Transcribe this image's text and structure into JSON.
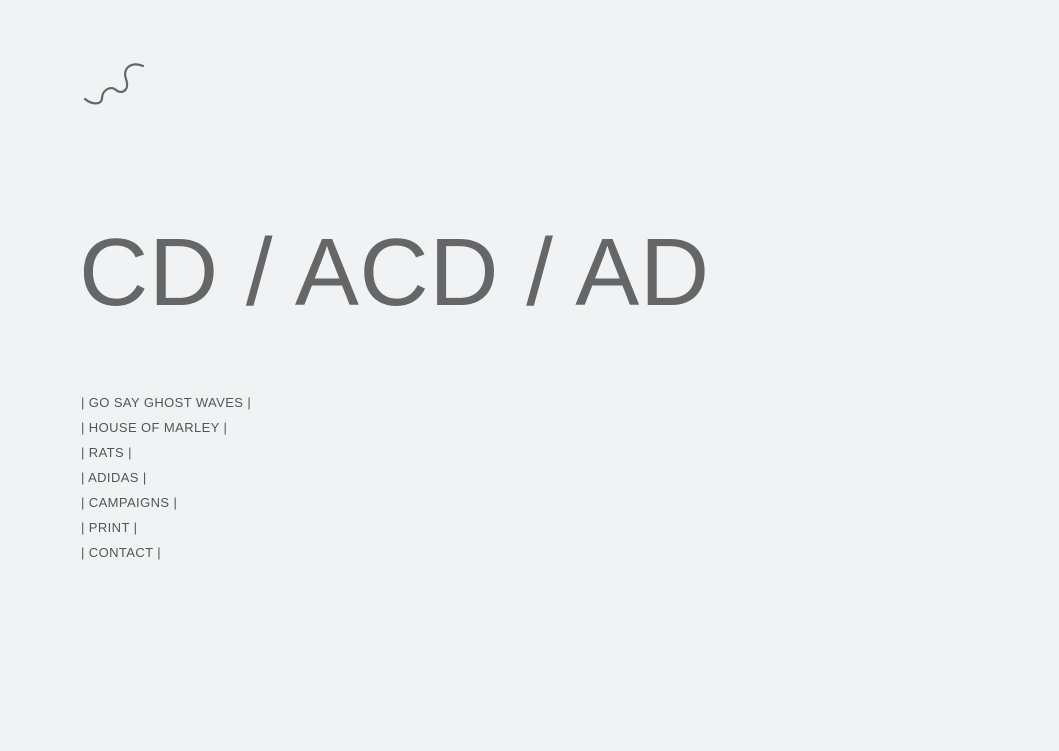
{
  "header": {
    "logo_icon": "squiggle-wave-icon"
  },
  "hero": {
    "title": "CD / ACD / AD"
  },
  "nav": {
    "items": [
      {
        "label": "| GO SAY GHOST WAVES |"
      },
      {
        "label": "| HOUSE OF MARLEY |"
      },
      {
        "label": "| RATS |"
      },
      {
        "label": "| ADIDAS |"
      },
      {
        "label": "| CAMPAIGNS |"
      },
      {
        "label": "| PRINT |"
      },
      {
        "label": "| CONTACT |"
      }
    ]
  },
  "colors": {
    "background": "#f1f2f4",
    "text": "#666666"
  }
}
